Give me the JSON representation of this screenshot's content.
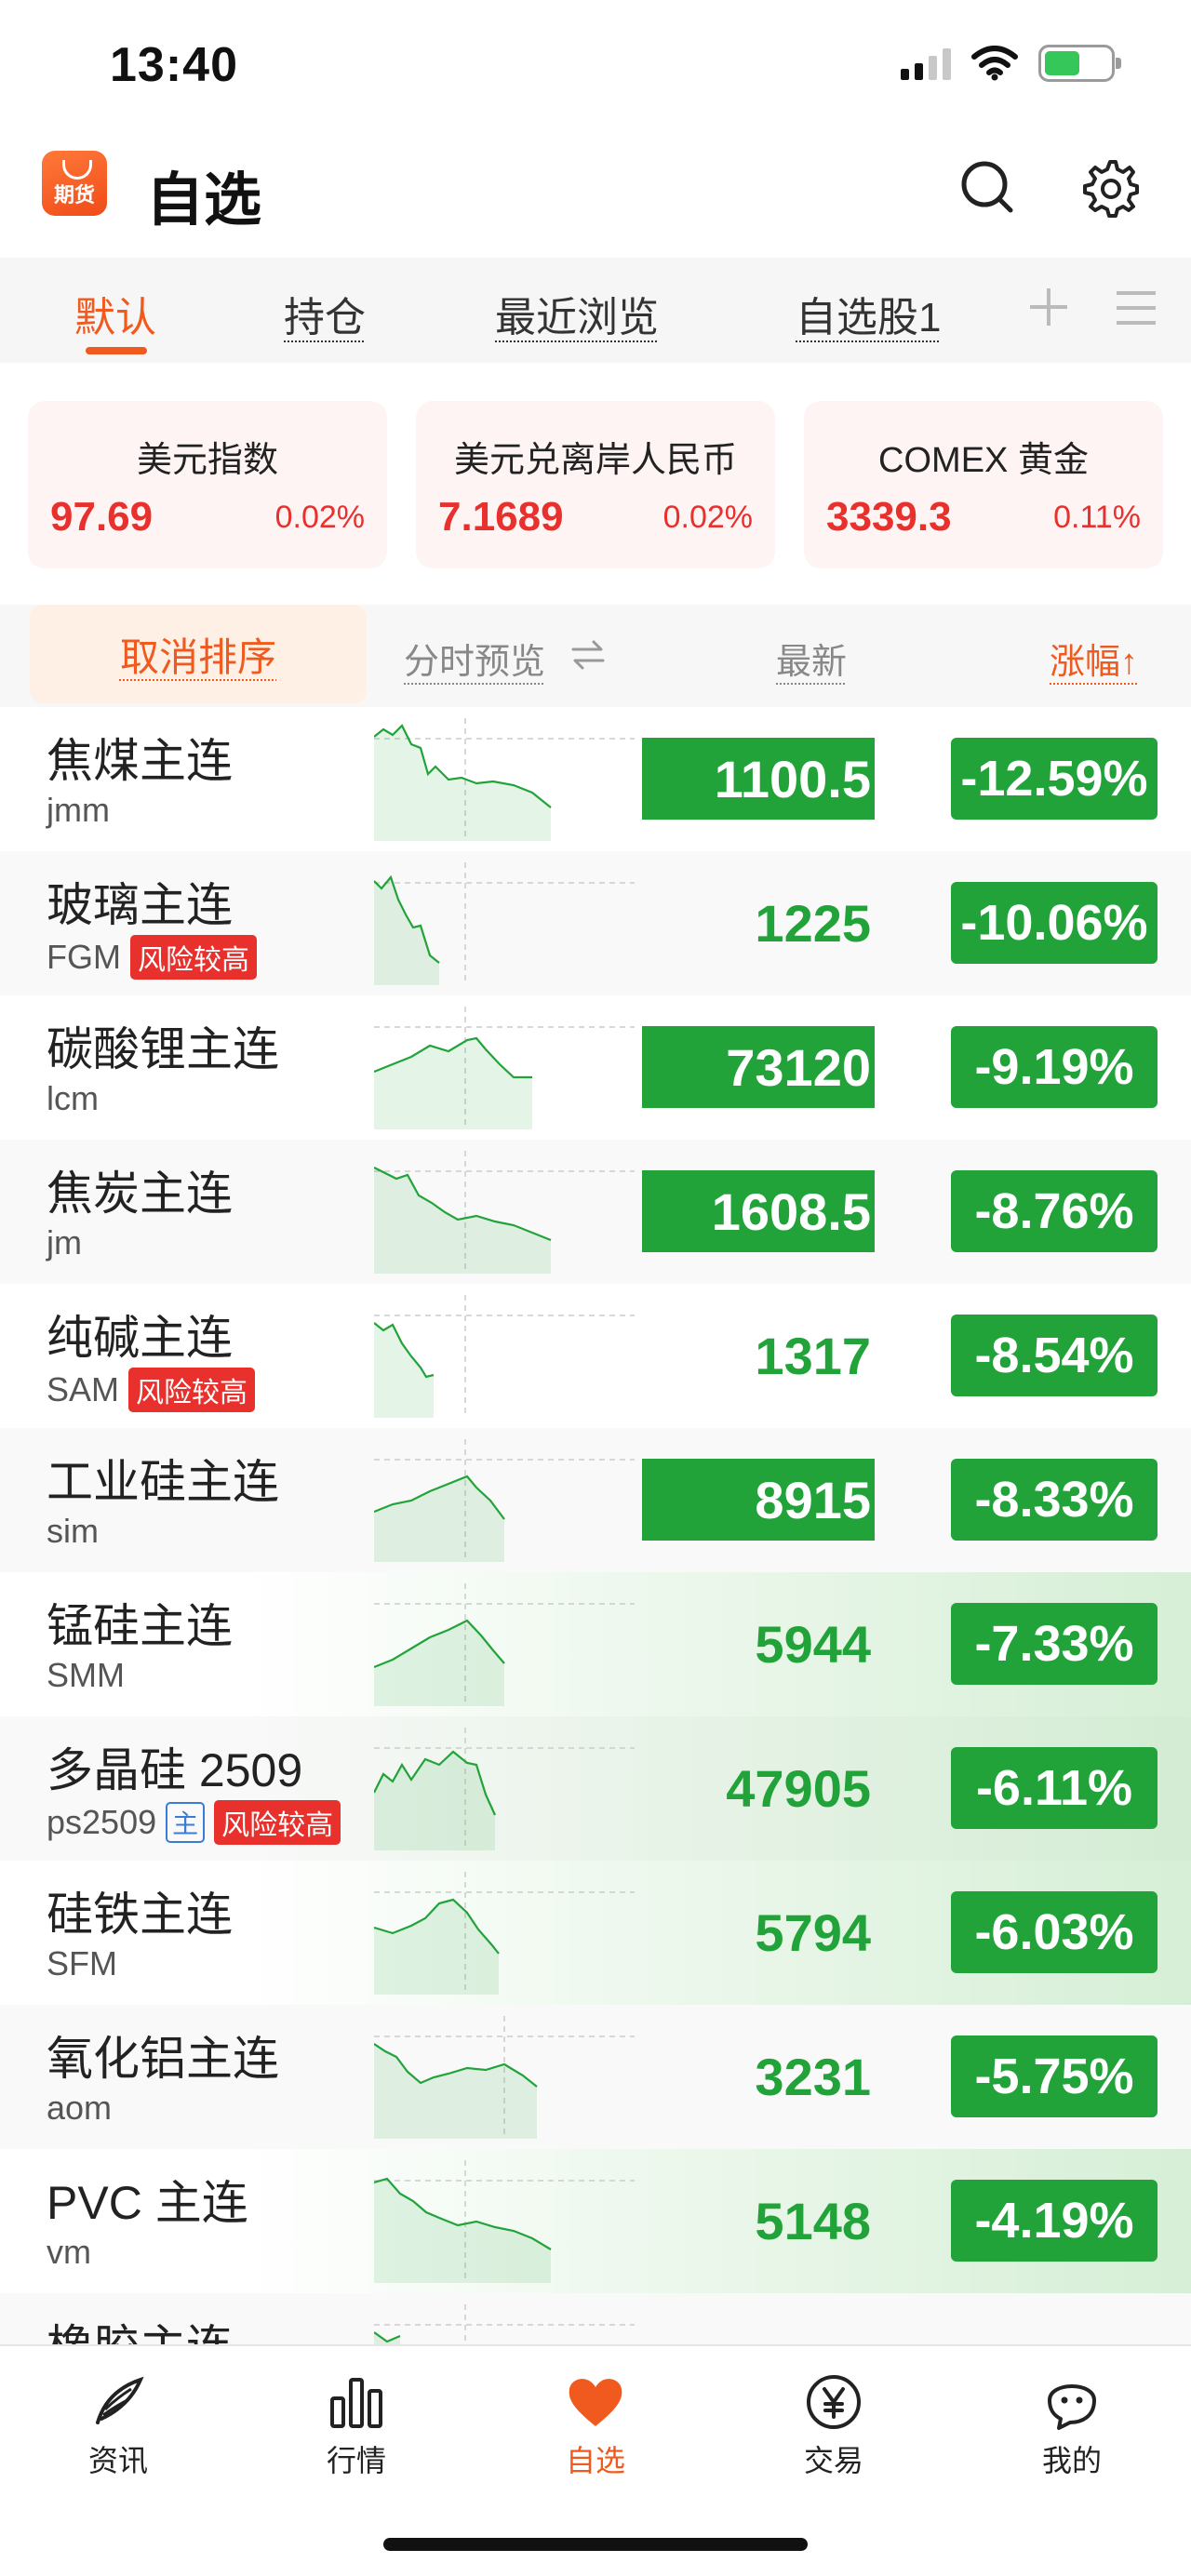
{
  "status": {
    "time": "13:40"
  },
  "header": {
    "logo_text": "期货",
    "title": "自选"
  },
  "tabs": [
    {
      "label": "默认",
      "active": true
    },
    {
      "label": "持仓"
    },
    {
      "label": "最近浏览"
    },
    {
      "label": "自选股1"
    }
  ],
  "indices": [
    {
      "name": "美元指数",
      "price": "97.69",
      "change": "0.02%"
    },
    {
      "name": "美元兑离岸人民币",
      "price": "7.1689",
      "change": "0.02%"
    },
    {
      "name": "COMEX 黄金",
      "price": "3339.3",
      "change": "0.11%"
    }
  ],
  "sort_bar": {
    "cancel_sort": "取消排序",
    "preview": "分时预览",
    "latest": "最新",
    "change": "涨幅↑"
  },
  "rows": [
    {
      "name": "焦煤主连",
      "code": "jmm",
      "price": "1100.5",
      "change": "-12.59%",
      "price_highlight": true
    },
    {
      "name": "玻璃主连",
      "code": "FGM",
      "badges": [
        "风险较高"
      ],
      "price": "1225",
      "change": "-10.06%"
    },
    {
      "name": "碳酸锂主连",
      "code": "lcm",
      "price": "73120",
      "change": "-9.19%",
      "price_highlight": true
    },
    {
      "name": "焦炭主连",
      "code": "jm",
      "price": "1608.5",
      "change": "-8.76%",
      "price_highlight": true
    },
    {
      "name": "纯碱主连",
      "code": "SAM",
      "badges": [
        "风险较高"
      ],
      "price": "1317",
      "change": "-8.54%"
    },
    {
      "name": "工业硅主连",
      "code": "sim",
      "price": "8915",
      "change": "-8.33%",
      "price_highlight": true
    },
    {
      "name": "锰硅主连",
      "code": "SMM",
      "price": "5944",
      "change": "-7.33%"
    },
    {
      "name": "多晶硅 2509",
      "code": "ps2509",
      "main_badge": "主",
      "badges": [
        "风险较高"
      ],
      "price": "47905",
      "change": "-6.11%"
    },
    {
      "name": "硅铁主连",
      "code": "SFM",
      "price": "5794",
      "change": "-6.03%"
    },
    {
      "name": "氧化铝主连",
      "code": "aom",
      "price": "3231",
      "change": "-5.75%"
    },
    {
      "name": "PVC 主连",
      "code": "vm",
      "price": "5148",
      "change": "-4.19%"
    },
    {
      "name": "橡胶主连",
      "code": "",
      "price": "",
      "change": ""
    }
  ],
  "bottom_nav": [
    {
      "label": "资讯",
      "icon": "feather-icon"
    },
    {
      "label": "行情",
      "icon": "bar-chart-icon"
    },
    {
      "label": "自选",
      "icon": "heart-icon",
      "active": true
    },
    {
      "label": "交易",
      "icon": "yen-icon"
    },
    {
      "label": "我的",
      "icon": "person-icon"
    }
  ],
  "colors": {
    "accent": "#f05a1e",
    "down_green": "#22a33a",
    "up_red": "#e8302d"
  }
}
